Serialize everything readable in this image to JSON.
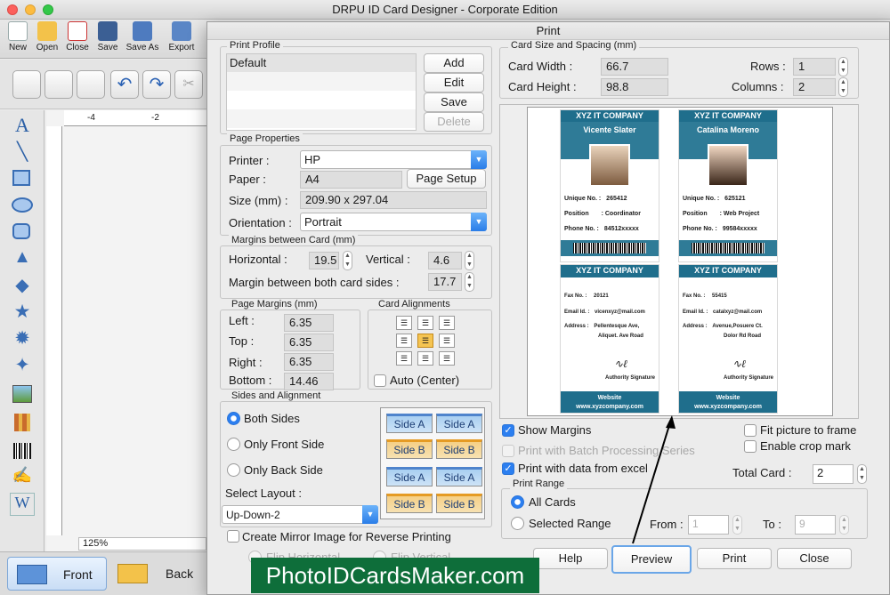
{
  "app": {
    "title": "DRPU ID Card Designer - Corporate Edition",
    "toolbar": [
      "New",
      "Open",
      "Close",
      "Save",
      "Save As",
      "Export"
    ],
    "zoom": "125%",
    "ruler_labels": [
      "-4",
      "-2"
    ],
    "front_tab": "Front",
    "back_tab": "Back"
  },
  "dialog": {
    "title": "Print",
    "print_profile": {
      "label": "Print Profile",
      "items": [
        "Default"
      ],
      "buttons": {
        "add": "Add",
        "edit": "Edit",
        "save": "Save",
        "delete": "Delete"
      }
    },
    "page_properties": {
      "label": "Page Properties",
      "printer_label": "Printer :",
      "printer_value": "HP",
      "paper_label": "Paper :",
      "paper_value": "A4",
      "page_setup": "Page Setup",
      "size_label": "Size (mm) :",
      "size_value": "209.90 x 297.04",
      "orientation_label": "Orientation :",
      "orientation_value": "Portrait"
    },
    "margins_card": {
      "label": "Margins between Card (mm)",
      "horizontal_label": "Horizontal :",
      "horizontal_value": "19.5",
      "vertical_label": "Vertical :",
      "vertical_value": "4.6",
      "both_label": "Margin between both card sides :",
      "both_value": "17.7"
    },
    "page_margins": {
      "label": "Page Margins (mm)",
      "left_label": "Left :",
      "left_value": "6.35",
      "top_label": "Top :",
      "top_value": "6.35",
      "right_label": "Right :",
      "right_value": "6.35",
      "bottom_label": "Bottom :",
      "bottom_value": "14.46"
    },
    "card_alignments": {
      "label": "Card Alignments",
      "auto_center": "Auto (Center)"
    },
    "sides": {
      "label": "Sides and Alignment",
      "both": "Both Sides",
      "front": "Only Front Side",
      "back": "Only Back Side",
      "layout_label": "Select Layout :",
      "layout_value": "Up-Down-2",
      "side_a": "Side A",
      "side_b": "Side B"
    },
    "mirror": {
      "label": "Create Mirror Image for Reverse Printing",
      "flip_h": "Flip Horizontal",
      "flip_v": "Flip Vertical"
    },
    "card_size": {
      "label": "Card Size and Spacing (mm)",
      "width_label": "Card Width :",
      "width_value": "66.7",
      "height_label": "Card Height :",
      "height_value": "98.8",
      "rows_label": "Rows :",
      "rows_value": "1",
      "columns_label": "Columns :",
      "columns_value": "2"
    },
    "cards": [
      {
        "company": "XYZ IT COMPANY",
        "name": "Vicente Slater",
        "unique": "265412",
        "position": "Coordinator",
        "phone": "84512xxxxx",
        "fax": "20121",
        "email": "vicenxyz@mail.com",
        "address1": "Pellentesque Ave,",
        "address2": "Aliquet. Ave Road"
      },
      {
        "company": "XYZ IT COMPANY",
        "name": "Catalina Moreno",
        "unique": "625121",
        "position": "Web Project",
        "phone": "99584xxxxx",
        "fax": "55415",
        "email": "catalxyz@mail.com",
        "address1": "Avenue,Posuere Ct.",
        "address2": "Dolor  Rd Road"
      }
    ],
    "card_labels": {
      "unique": "Unique No. :",
      "position": "Position",
      "phone": "Phone No. :",
      "fax": "Fax No. :",
      "email": "Email Id. :",
      "address": "Address :",
      "signature": "Authority Signature",
      "website_label": "Website",
      "website": "www.xyzcompany.com"
    },
    "options": {
      "show_margins": "Show Margins",
      "batch": "Print with Batch Processing Series",
      "print_data": "Print with data from excel",
      "fit_picture": "Fit picture to frame",
      "crop_mark": "Enable crop mark",
      "total_card_label": "Total Card :",
      "total_card_value": "2"
    },
    "print_range": {
      "label": "Print Range",
      "all": "All Cards",
      "selected": "Selected Range",
      "from_label": "From :",
      "from_value": "1",
      "to_label": "To :",
      "to_value": "9"
    },
    "buttons": {
      "help": "Help",
      "preview": "Preview",
      "print": "Print",
      "close": "Close"
    }
  },
  "watermark": "PhotoIDCardsMaker.com"
}
